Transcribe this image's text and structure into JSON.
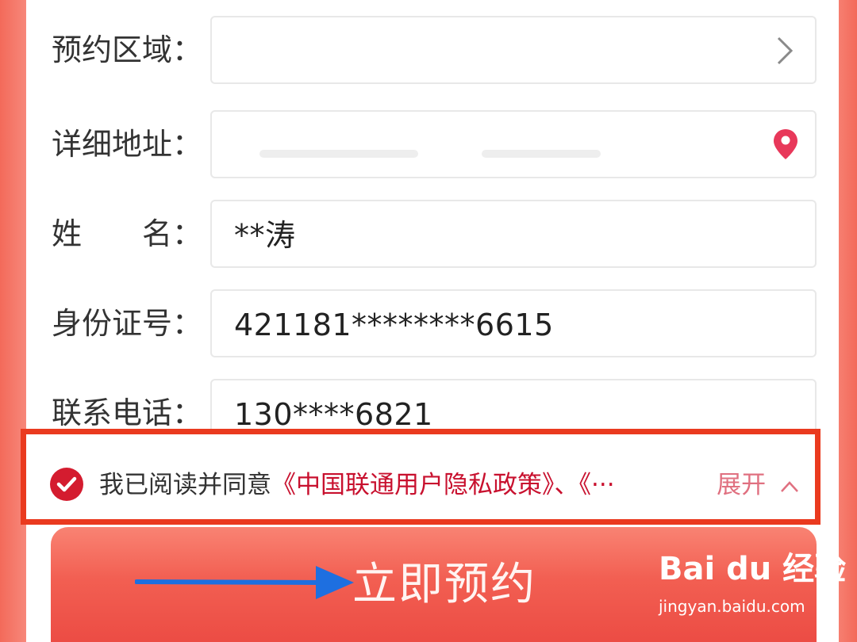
{
  "form": {
    "region": {
      "label": "预约区域：",
      "value": "",
      "icon": "chevron-right-icon"
    },
    "address": {
      "label": "详细地址：",
      "value": "",
      "icon": "location-pin-icon"
    },
    "name": {
      "label": "姓　　名：",
      "value": "**涛"
    },
    "id_number": {
      "label": "身份证号：",
      "value": "421181********6615"
    },
    "phone": {
      "label": "联系电话：",
      "value": "130****6821"
    }
  },
  "agreement": {
    "checked": true,
    "prefix": "我已阅读并同意",
    "policy": "《中国联通用户隐私政策》、《···",
    "expand_label": "展开",
    "expand_icon": "chevron-up-icon"
  },
  "submit": {
    "label": "立即预约"
  },
  "watermark": {
    "logo": "Bai du 经验",
    "url": "jingyan.baidu.com"
  },
  "colors": {
    "accent": "#c8102e",
    "highlight_box": "#ea3a1f",
    "button": "#f25f52",
    "arrow": "#1e6fe0"
  }
}
